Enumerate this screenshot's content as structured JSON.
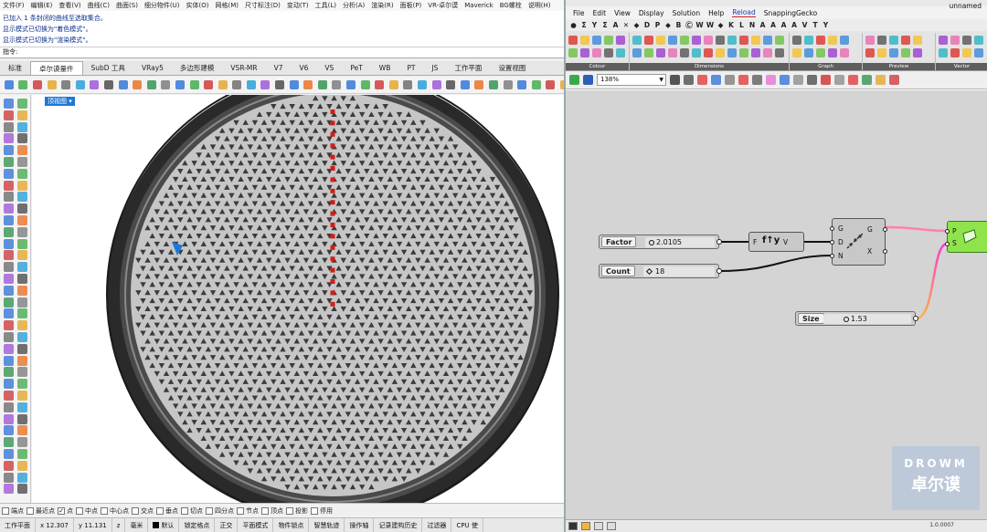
{
  "rhino": {
    "menu": [
      "文件(F)",
      "编辑(E)",
      "查看(V)",
      "曲线(C)",
      "曲面(S)",
      "细分物件(U)",
      "实体(O)",
      "网格(M)",
      "尺寸标注(D)",
      "变动(T)",
      "工具(L)",
      "分析(A)",
      "渲染(R)",
      "面板(P)",
      "VR-卓尔谟",
      "Maverick",
      "BG螺栓",
      "说明(H)"
    ],
    "history": [
      "已加入 1 条封闭的曲线至选取集合。",
      "显示模式已切换为\"着色模式\"。",
      "显示模式已切换为\"渲染模式\"。"
    ],
    "command_prompt": "指令:",
    "tabs": [
      "标准",
      "卓尔谟量件",
      "SubD 工具",
      "VRay5",
      "多边形建模",
      "VSR-MR",
      "V7",
      "V6",
      "VS",
      "PeT",
      "WB",
      "PT",
      "JS",
      "工作平面",
      "设置视图"
    ],
    "active_tab": "卓尔谟量件",
    "viewport_label": "顶视图 ▾",
    "osnaps": [
      {
        "label": "端点",
        "checked": false
      },
      {
        "label": "最近点",
        "checked": false
      },
      {
        "label": "点",
        "checked": true
      },
      {
        "label": "中点",
        "checked": false
      },
      {
        "label": "中心点",
        "checked": false
      },
      {
        "label": "交点",
        "checked": false
      },
      {
        "label": "垂点",
        "checked": false
      },
      {
        "label": "切点",
        "checked": false
      },
      {
        "label": "四分点",
        "checked": false
      },
      {
        "label": "节点",
        "checked": false
      },
      {
        "label": "顶点",
        "checked": false
      },
      {
        "label": "投影",
        "checked": false
      },
      {
        "label": "停用",
        "checked": false
      }
    ],
    "status": [
      "工作平面",
      "x 12.307",
      "y 11.131",
      "z",
      "毫米",
      "默认",
      "锁定格点",
      "正交",
      "平面模式",
      "物件锁点",
      "智慧轨迹",
      "操作轴",
      "记录建构历史",
      "过滤器",
      "CPU 使"
    ]
  },
  "grasshopper": {
    "menu": [
      "File",
      "Edit",
      "View",
      "Display",
      "Solution",
      "Help",
      "Reload",
      "SnappingGecko"
    ],
    "doc_name": "unnamed",
    "top_icon_letters": [
      "●",
      "Σ",
      "Y",
      "Σ",
      "A",
      "✕",
      "◆",
      "D",
      "P",
      "◆",
      "B",
      "Ⓒ",
      "W",
      "W",
      "◆",
      "K",
      "L",
      "N",
      "A",
      "A",
      "A",
      "A",
      "V",
      "T",
      "Y"
    ],
    "ribbon_panels": [
      "Colour",
      "Dimensions",
      "Graph",
      "Preview",
      "Vector"
    ],
    "zoom": "138%",
    "nodes": {
      "factor": {
        "label": "Factor",
        "value": "2.0105"
      },
      "count": {
        "label": "Count",
        "value": "18"
      },
      "size": {
        "label": "Size",
        "value": "1.53"
      },
      "expr": {
        "in": "F",
        "out": "V",
        "glyph": "f↑y"
      },
      "divide": {
        "inputs": [
          "G",
          "D",
          "N"
        ],
        "outputs": [
          "G",
          "X"
        ]
      },
      "preview": {
        "inputs": [
          "P",
          "S"
        ]
      }
    },
    "version": "1.0.0007",
    "watermark": {
      "line1": "DROWM",
      "line2": "卓尔谟"
    }
  },
  "colors": {
    "wire_dark": "#111111",
    "wire_pink": "#ff5fd0",
    "wire_orange": "#ffb24a",
    "preview_green": "#8fe34b",
    "selected_blue": "#1f78d8",
    "pattern_red": "#d21c1c"
  }
}
